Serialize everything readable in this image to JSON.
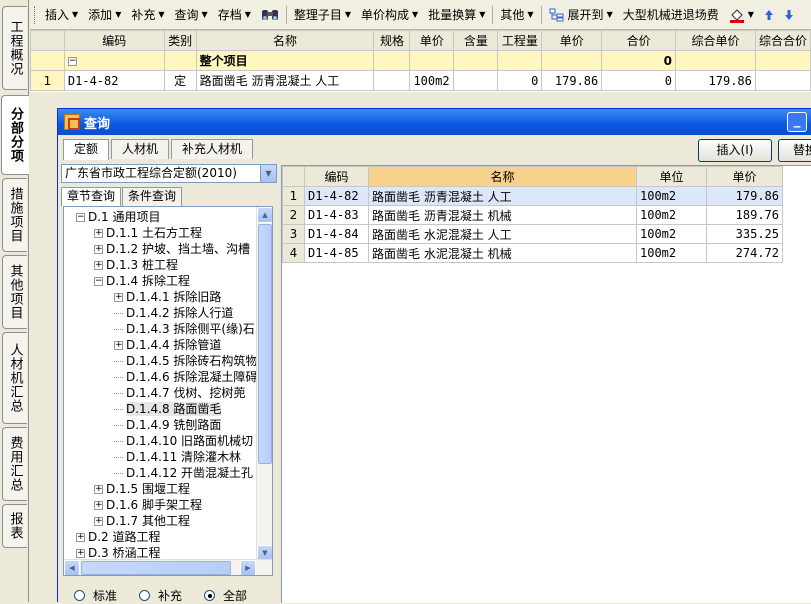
{
  "side_tabs": [
    {
      "label": "工程概况",
      "active": false
    },
    {
      "label": "分部分项",
      "active": true
    },
    {
      "label": "措施项目",
      "active": false
    },
    {
      "label": "其他项目",
      "active": false
    },
    {
      "label": "人材机汇总",
      "active": false
    },
    {
      "label": "费用汇总",
      "active": false
    },
    {
      "label": "报表",
      "active": false
    }
  ],
  "toolbar": {
    "insert": "插入",
    "add": "添加",
    "supplement": "补充",
    "query": "查询",
    "archive": "存档",
    "organize": "整理子目",
    "unit_price_comp": "单价构成",
    "batch_convert": "批量换算",
    "other": "其他",
    "expand_to": "展开到",
    "machinery": "大型机械进退场费"
  },
  "main_grid": {
    "headers": [
      "编码",
      "类别",
      "名称",
      "规格",
      "单价",
      "含量",
      "工程量",
      "单价",
      "合价",
      "综合单价",
      "综合合价"
    ],
    "total_row": {
      "toggle": "−",
      "name": "整个项目",
      "total": "0"
    },
    "rows": [
      {
        "no": "1",
        "code": "D1-4-82",
        "type": "定",
        "name": "路面凿毛 沥青混凝土 人工",
        "spec": "",
        "unit": "100m2",
        "content": "",
        "quantity": "0",
        "unit_price": "179.86",
        "amount": "0",
        "comp_unit_price": "179.86",
        "comp_amount": ""
      }
    ]
  },
  "dialog": {
    "title": "查询",
    "tabs": [
      "定额",
      "人材机",
      "补充人材机"
    ],
    "insert_button": "插入(I)",
    "replace_button": "替换",
    "quota_library": "广东省市政工程综合定额(2010)",
    "search_tabs": [
      "章节查询",
      "条件查询"
    ],
    "tree": [
      {
        "label": "D.1 通用项目",
        "level": 0,
        "toggle": "−"
      },
      {
        "label": "D.1.1 土石方工程",
        "level": 1,
        "toggle": "+"
      },
      {
        "label": "D.1.2 护坡、挡土墙、沟槽",
        "level": 1,
        "toggle": "+"
      },
      {
        "label": "D.1.3 桩工程",
        "level": 1,
        "toggle": "+"
      },
      {
        "label": "D.1.4  拆除工程",
        "level": 1,
        "toggle": "−"
      },
      {
        "label": "D.1.4.1 拆除旧路",
        "level": 2,
        "toggle": "+"
      },
      {
        "label": "D.1.4.2 拆除人行道",
        "level": 2,
        "toggle": ""
      },
      {
        "label": "D.1.4.3 拆除侧平(缘)石",
        "level": 2,
        "toggle": ""
      },
      {
        "label": "D.1.4.4 拆除管道",
        "level": 2,
        "toggle": "+"
      },
      {
        "label": "D.1.4.5 拆除砖石构筑物",
        "level": 2,
        "toggle": ""
      },
      {
        "label": "D.1.4.6 拆除混凝土障碍",
        "level": 2,
        "toggle": ""
      },
      {
        "label": "D.1.4.7 伐树、挖树蔸",
        "level": 2,
        "toggle": ""
      },
      {
        "label": "D.1.4.8 路面凿毛",
        "level": 2,
        "toggle": "",
        "selected": true
      },
      {
        "label": "D.1.4.9 铣刨路面",
        "level": 2,
        "toggle": ""
      },
      {
        "label": "D.1.4.10 旧路面机械切",
        "level": 2,
        "toggle": ""
      },
      {
        "label": "D.1.4.11 清除灌木林",
        "level": 2,
        "toggle": ""
      },
      {
        "label": "D.1.4.12 开凿混凝土孔",
        "level": 2,
        "toggle": ""
      },
      {
        "label": "D.1.5 围堰工程",
        "level": 1,
        "toggle": "+"
      },
      {
        "label": "D.1.6 脚手架工程",
        "level": 1,
        "toggle": "+"
      },
      {
        "label": "D.1.7 其他工程",
        "level": 1,
        "toggle": "+"
      },
      {
        "label": "D.2 道路工程",
        "level": 0,
        "toggle": "+"
      },
      {
        "label": "D.3 桥涵工程",
        "level": 0,
        "toggle": "+"
      }
    ],
    "radios": [
      {
        "label": "标准",
        "checked": false
      },
      {
        "label": "补充",
        "checked": false
      },
      {
        "label": "全部",
        "checked": true
      }
    ],
    "results": {
      "headers": [
        "编码",
        "名称",
        "单位",
        "单价"
      ],
      "rows": [
        {
          "no": "1",
          "code": "D1-4-82",
          "name": "路面凿毛 沥青混凝土 人工",
          "unit": "100m2",
          "price": "179.86"
        },
        {
          "no": "2",
          "code": "D1-4-83",
          "name": "路面凿毛 沥青混凝土 机械",
          "unit": "100m2",
          "price": "189.76"
        },
        {
          "no": "3",
          "code": "D1-4-84",
          "name": "路面凿毛 水泥混凝土 人工",
          "unit": "100m2",
          "price": "335.25"
        },
        {
          "no": "4",
          "code": "D1-4-85",
          "name": "路面凿毛 水泥混凝土 机械",
          "unit": "100m2",
          "price": "274.72"
        }
      ]
    }
  }
}
